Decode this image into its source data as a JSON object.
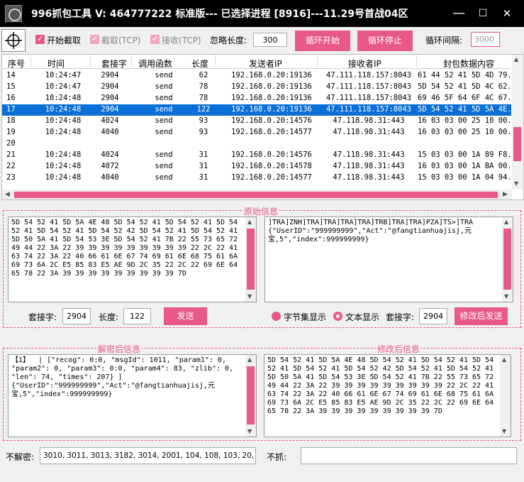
{
  "window": {
    "title": "996抓包工具  V: 464777222 标准版--- 已选择进程 [8916]---11.29号首战04区",
    "minimize": "—",
    "maximize": "☐",
    "close": "✕"
  },
  "toolbar": {
    "start_capture": "开始截取",
    "capture_tcp": "截取(TCP)",
    "receive_tcp": "接收(TCP)",
    "ignore_length_label": "忽略长度:",
    "ignore_length_value": "300",
    "loop_start": "循环开始",
    "loop_stop": "循环停止",
    "loop_interval_label": "循环间隔:",
    "loop_interval_value": "3000"
  },
  "table": {
    "headers": [
      "序号",
      "时间",
      "套接字",
      "调用函数",
      "长度",
      "发送者IP",
      "接收者IP",
      "封包数据内容"
    ],
    "rows": [
      [
        "14",
        "10:24:47",
        "2904",
        "send",
        "62",
        "192.168.0.20:19136",
        "47.111.118.157:8043",
        "61 44 52 41 5D 4D 79..."
      ],
      [
        "15",
        "10:24:47",
        "2904",
        "send",
        "78",
        "192.168.0.20:19136",
        "47.111.118.157:8043",
        "5D 54 52 41 5D 4C 62..."
      ],
      [
        "16",
        "10:24:48",
        "2904",
        "send",
        "78",
        "192.168.0.20:19136",
        "47.111.118.157:8043",
        "69 46 5F 64 6F 4C 67..."
      ],
      [
        "17",
        "10:24:48",
        "2904",
        "send",
        "122",
        "192.168.0.20:19136",
        "47.111.118.157:8043",
        "5D 54 52 41 5D 5A 4E..."
      ],
      [
        "18",
        "10:24:48",
        "4024",
        "send",
        "93",
        "192.168.0.20:14576",
        "47.118.98.31:443",
        "16 03 03 00 25 10 00..."
      ],
      [
        "19",
        "10:24:48",
        "4040",
        "send",
        "93",
        "192.168.0.20:14577",
        "47.118.98.31:443",
        "16 03 03 00 25 10 00..."
      ],
      [
        "20",
        "",
        "",
        "",
        "",
        "",
        "",
        ""
      ],
      [
        "21",
        "10:24:48",
        "4024",
        "send",
        "31",
        "192.168.0.20:14576",
        "47.118.98.31:443",
        "15 03 03 00 1A 89 F8..."
      ],
      [
        "22",
        "10:24:48",
        "4072",
        "send",
        "31",
        "192.168.0.20:14578",
        "47.118.98.31:443",
        "16 03 03 00 1A BA 00..."
      ],
      [
        "23",
        "10:24:48",
        "4040",
        "send",
        "31",
        "192.168.0.20:14577",
        "47.118.98.31:443",
        "15 03 03 00 1A 04 94..."
      ]
    ],
    "selected_index": 3
  },
  "original": {
    "title": "原始信息",
    "hex": "5D 54 52 41 5D 5A 4E 48 5D 54 52 41 5D 54 52 41 5D 54\n52 41 5D 54 52 41 5D 54 52 42 5D 54 52 41 5D 54 52 41\n5D 50 5A 41 5D 54 53 3E 5D 54 52 41 7B 22 55 73 65 72\n49 44 22 3A 22 39 39 39 39 39 39 39 39 39 22 2C 22 41\n63 74 22 3A 22 40 66 61 6E 67 74 69 61 6E 68 75 61 6A\n69 73 6A 2C E5 85 83 E5 AE 9D 2C 35 22 2C 22 69 6E 64\n65 78 22 3A 39 39 39 39 39 39 39 39 39 7D",
    "text": "]TRA]ZNH]TRA]TRA]TRA]TRA]TRB]TRA]TRA]PZA]TS>]TRA\n{\"UserID\":\"999999999\",\"Act\":\"@fangtianhuajisj,元\n宝,5\",\"index\":999999999}",
    "socket_label": "套接字:",
    "socket_value": "2904",
    "length_label": "长度:",
    "length_value": "122",
    "send_button": "发送",
    "byteset_label": "字节集显示",
    "textshow_label": "文本显示",
    "socket2_label": "套接字:",
    "socket2_value": "2904",
    "modify_send_button": "修改后发送"
  },
  "decrypted": {
    "title": "解密后信息",
    "text": "【1】  | [\"recog\": 0:0, \"msgId\": 1011, \"param1\": 0,\n\"param2\": 0, \"param3\": 0:0, \"param4\": 83, \"zlib\": 0,\n\"len\": 74, \"times\": 207} ]\n{\"UserID\":\"999999999\",\"Act\":\"@fangtianhuajisj,元\n宝,5\",\"index\":999999999}"
  },
  "modified": {
    "title": "修改后信息",
    "hex": "5D 54 52 41 5D 5A 4E 48 5D 54 52 41 5D 54 52 41 5D 54\n52 41 5D 54 52 41 5D 54 52 42 5D 54 52 41 5D 54 52 41\n5D 50 5A 41 5D 54 53 3E 5D 54 52 41 7B 22 55 73 65 72\n49 44 22 3A 22 39 39 39 39 39 39 39 39 39 22 2C 22 41\n63 74 22 3A 22 40 66 61 6E 67 74 69 61 6E 68 75 61 6A\n69 73 6A 2C E5 85 83 E5 AE 9D 2C 35 22 2C 22 69 6E 64\n65 78 22 3A 39 39 39 39 39 39 39 39 39 7D"
  },
  "footer": {
    "no_decrypt_label": "不解密:",
    "no_decrypt_value": "3010, 3011, 3013, 3182, 3014, 2001, 104, 108, 103, 20, 1018, 2",
    "no_capture_label": "不抓:",
    "no_capture_value": ""
  },
  "colors": {
    "accent": "#e8588a",
    "selection": "#0a6fd6"
  }
}
